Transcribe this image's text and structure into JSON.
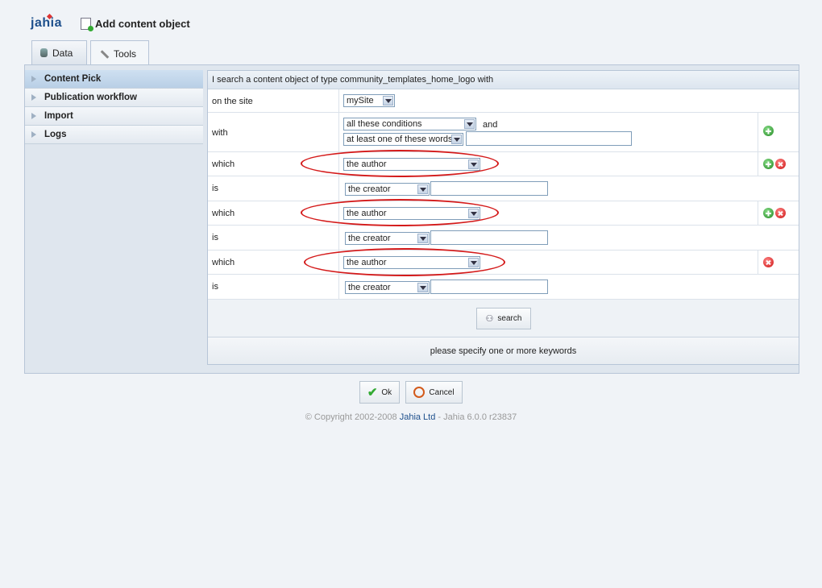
{
  "app": {
    "logo": "jahia",
    "title": "Add content object"
  },
  "tabs": [
    {
      "label": "Data"
    },
    {
      "label": "Tools"
    }
  ],
  "sidebar": {
    "items": [
      {
        "label": "Content Pick"
      },
      {
        "label": "Publication workflow"
      },
      {
        "label": "Import"
      },
      {
        "label": "Logs"
      }
    ]
  },
  "search": {
    "header": "I search a content object of type community_templates_home_logo with",
    "site_label": "on the site",
    "site_value": "mySite",
    "with_label": "with",
    "with_value1": "all these conditions",
    "and_label": "and",
    "with_value2": "at least one of these words",
    "rows": [
      {
        "which_label": "which",
        "which_value": "the author",
        "is_label": "is",
        "is_value": "the creator"
      },
      {
        "which_label": "which",
        "which_value": "the author",
        "is_label": "is",
        "is_value": "the creator"
      },
      {
        "which_label": "which",
        "which_value": "the author",
        "is_label": "is",
        "is_value": "the creator"
      }
    ],
    "search_button": "search",
    "status": "please specify one or more keywords"
  },
  "dialog": {
    "ok": "Ok",
    "cancel": "Cancel"
  },
  "footer": {
    "prefix": "© Copyright 2002-2008 ",
    "company": "Jahia Ltd",
    "suffix": " - Jahia 6.0.0 r23837"
  },
  "colors": {
    "accent": "#1d4f8c",
    "highlight": "#d41a1a"
  }
}
